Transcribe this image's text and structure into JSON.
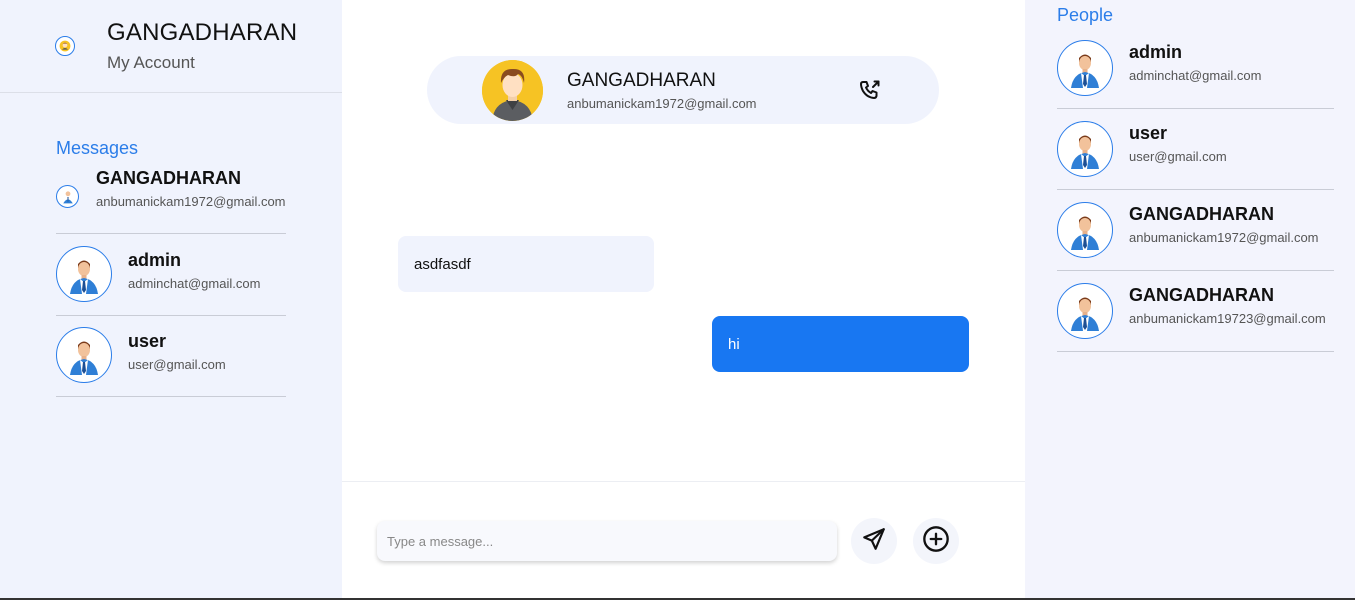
{
  "account": {
    "name": "GANGADHARAN",
    "subtitle": "My Account",
    "avatar_icon": "user-avatar-icon"
  },
  "messages_panel": {
    "title": "Messages",
    "items": [
      {
        "name": "GANGADHARAN",
        "email": "anbumanickam1972@gmail.com",
        "avatar_icon": "user-avatar-icon"
      },
      {
        "name": "admin",
        "email": "adminchat@gmail.com",
        "avatar_icon": "businessman-avatar-icon"
      },
      {
        "name": "user",
        "email": "user@gmail.com",
        "avatar_icon": "businessman-avatar-icon"
      }
    ]
  },
  "chat": {
    "header": {
      "name": "GANGADHARAN",
      "email": "anbumanickam1972@gmail.com",
      "avatar_icon": "user-avatar-icon",
      "call_icon": "phone-call-icon"
    },
    "messages": [
      {
        "direction": "incoming",
        "text": "asdfasdf"
      },
      {
        "direction": "outgoing",
        "text": "hi"
      }
    ],
    "composer": {
      "placeholder": "Type a message...",
      "value": "",
      "send_icon": "send-icon",
      "add_icon": "plus-circle-icon"
    }
  },
  "people_panel": {
    "title": "People",
    "items": [
      {
        "name": "admin",
        "email": "adminchat@gmail.com",
        "avatar_icon": "businessman-avatar-icon"
      },
      {
        "name": "user",
        "email": "user@gmail.com",
        "avatar_icon": "businessman-avatar-icon"
      },
      {
        "name": "GANGADHARAN",
        "email": "anbumanickam1972@gmail.com",
        "avatar_icon": "businessman-avatar-icon"
      },
      {
        "name": "GANGADHARAN",
        "email": "anbumanickam19723@gmail.com",
        "avatar_icon": "businessman-avatar-icon"
      }
    ]
  },
  "colors": {
    "accent": "#2b7de9",
    "outgoing_bubble": "#1877f2",
    "sidebar_bg": "#f0f3fd",
    "header_avatar_bg": "#f6c324"
  }
}
